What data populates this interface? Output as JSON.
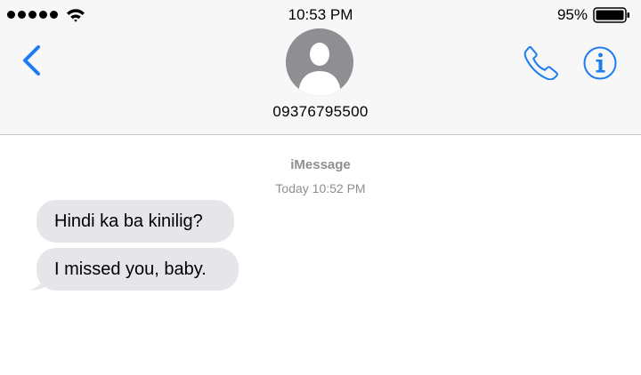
{
  "status_bar": {
    "time": "10:53 PM",
    "battery_percent": "95%",
    "signal_bars": 5,
    "battery_level": 0.95
  },
  "header": {
    "contact": "09376795500"
  },
  "conversation": {
    "service": "iMessage",
    "timestamp": "Today 10:52 PM",
    "messages": [
      {
        "direction": "incoming",
        "text": "Hindi ka ba kinilig?"
      },
      {
        "direction": "incoming",
        "text": "I missed you, baby."
      }
    ]
  },
  "colors": {
    "accent": "#1c7cf0",
    "bubble_incoming": "#e5e5ea",
    "secondary_text": "#8e8e93",
    "avatar": "#8e8e93"
  }
}
